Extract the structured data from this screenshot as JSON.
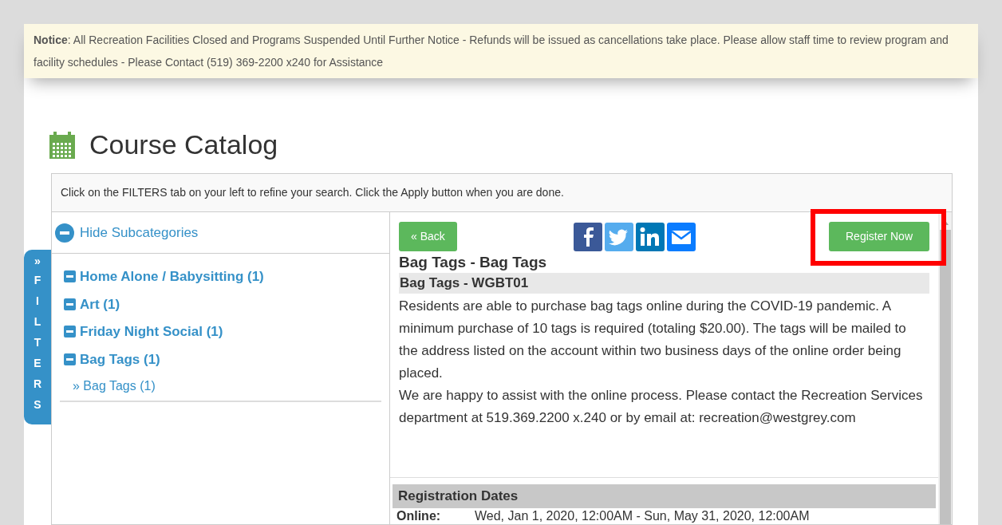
{
  "notice": {
    "text": "**Notice**: All Recreation Facilities Closed and Programs Suspended Until Further Notice - Refunds will be issued as cancellations take place. Please allow staff time to review program and facility schedules - Please Contact (519) 369-2200 x240 for Assistance"
  },
  "page_title": "Course Catalog",
  "instructions": "Click on the FILTERS tab on your left to refine your search. Click the Apply button when you are done.",
  "filters_tab": {
    "arrow": "»",
    "label": "FILTERS"
  },
  "hide_subcategories": "Hide Subcategories",
  "categories": [
    {
      "label": "Home Alone / Babysitting (1)",
      "expanded": true
    },
    {
      "label": "Art (1)",
      "expanded": true
    },
    {
      "label": "Friday Night Social (1)",
      "expanded": true
    },
    {
      "label": "Bag Tags (1)",
      "expanded": true,
      "children": [
        {
          "label": "» Bag Tags (1)"
        }
      ]
    }
  ],
  "back_button": "« Back",
  "register_button": "Register Now",
  "course": {
    "title": "Bag Tags - Bag Tags",
    "code_heading": "Bag Tags - WGBT01",
    "description": [
      "Residents are able to purchase bag tags online during the COVID-19 pandemic. A minimum purchase of 10 tags is required (totaling $20.00). The tags will be mailed to the address listed on the account within two business days of the online order being placed.",
      "We are happy to assist with the online process. Please contact the Recreation Services department at 519.369.2200 x.240 or by email at: recreation@westgrey.com"
    ]
  },
  "registration": {
    "heading": "Registration Dates",
    "rows": [
      {
        "label": "Online:",
        "value": "Wed, Jan 1, 2020, 12:00AM - Sun, May 31, 2020, 12:00AM"
      }
    ]
  }
}
